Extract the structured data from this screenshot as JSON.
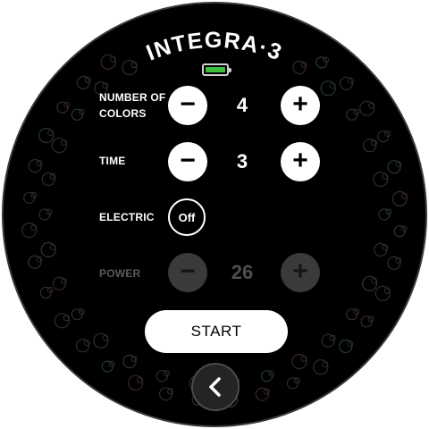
{
  "app": {
    "title": "INTEGRA·3"
  },
  "battery": {
    "level": 1.0,
    "color": "#3fbf3a"
  },
  "settings": {
    "colors": {
      "label_line1": "NUMBER OF",
      "label_line2": "COLORS",
      "value": "4"
    },
    "time": {
      "label": "TIME",
      "value": "3"
    },
    "electric": {
      "label": "ELECTRIC",
      "toggle": "Off"
    },
    "power": {
      "label": "POWER",
      "value": "26",
      "enabled": false
    }
  },
  "buttons": {
    "minus": "−",
    "plus": "+",
    "start": "START"
  },
  "icons": {
    "back": "chevron-left-icon",
    "battery": "battery-icon"
  }
}
